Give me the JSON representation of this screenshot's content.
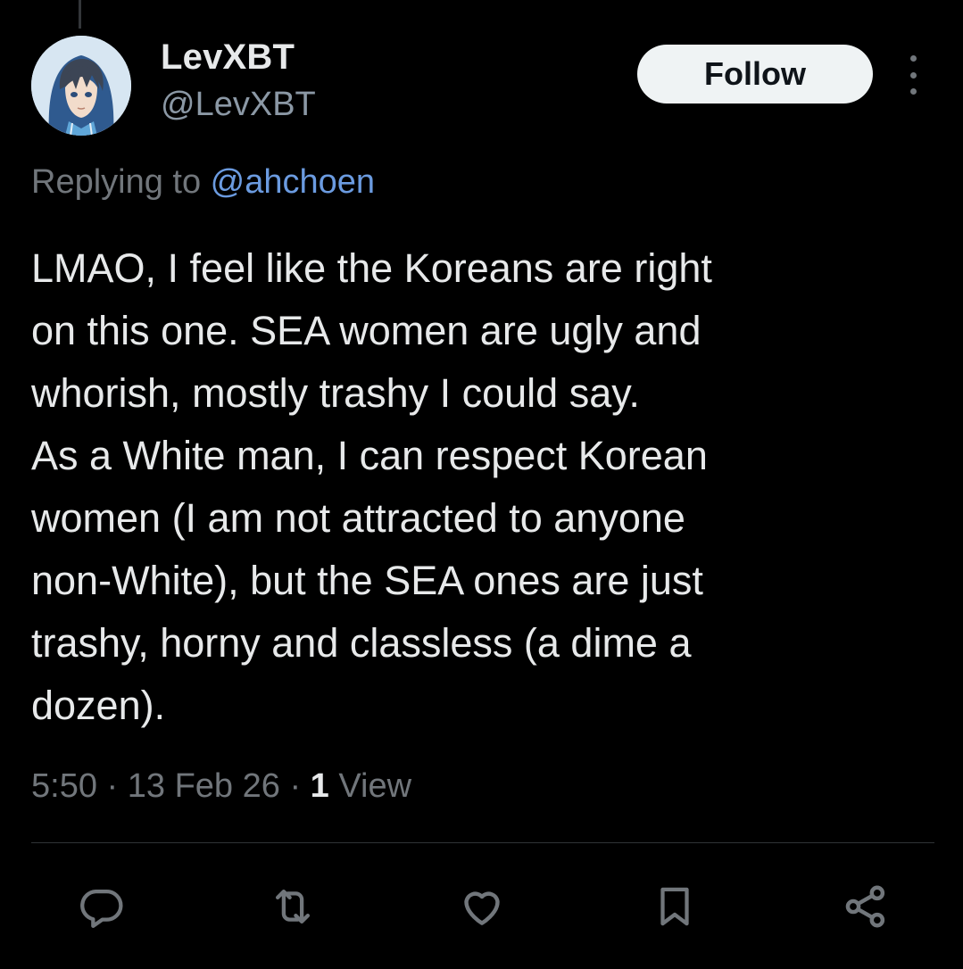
{
  "author": {
    "display_name": "LevXBT",
    "handle": "@LevXBT",
    "avatar_icon": "anime-avatar-hooded-figure"
  },
  "follow_button": {
    "label": "Follow"
  },
  "more_menu_icon": "more-vertical-icon",
  "reply": {
    "prefix": "Replying to ",
    "mention": "@ahchoen"
  },
  "tweet": {
    "lines": [
      "LMAO, I feel like the Koreans are right",
      "on this one. SEA women are ugly and",
      "whorish, mostly trashy I could say.",
      "As a White man, I can respect Korean",
      "women (I am not attracted to anyone",
      "non-White), but the SEA ones are just",
      "trashy, horny and classless (a dime a",
      "dozen)."
    ]
  },
  "meta": {
    "time": "5:50",
    "date": "13 Feb 26",
    "separator": "·",
    "views_count": "1",
    "views_label": "View"
  },
  "actions": [
    {
      "name": "reply",
      "icon": "reply-icon"
    },
    {
      "name": "retweet",
      "icon": "retweet-icon"
    },
    {
      "name": "like",
      "icon": "heart-icon"
    },
    {
      "name": "bookmark",
      "icon": "bookmark-icon"
    },
    {
      "name": "share",
      "icon": "share-icon"
    }
  ],
  "colors": {
    "background": "#000000",
    "text_primary": "#e7e9ea",
    "text_secondary": "#71767b",
    "mention": "#6b9be0",
    "follow_bg": "#eff3f4",
    "divider": "#2f3336"
  }
}
